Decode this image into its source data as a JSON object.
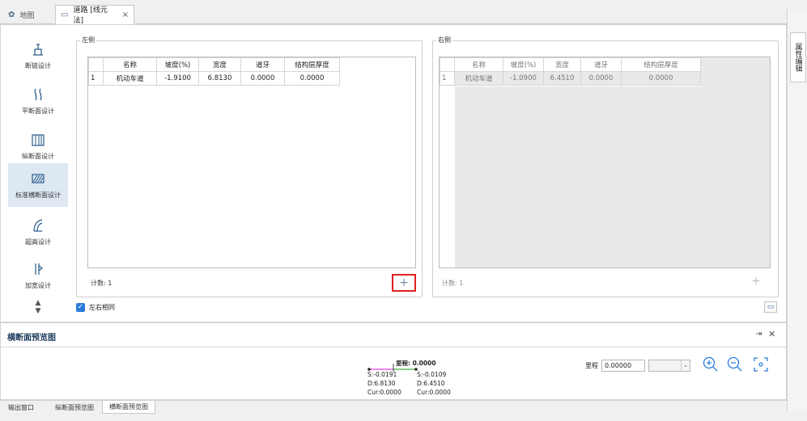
{
  "tabs": [
    {
      "label": "地图",
      "icon": "gear-icon"
    },
    {
      "label": "道路 [线元法]",
      "icon": "road-icon",
      "close": "×"
    }
  ],
  "right_panel_tab": "属性编辑",
  "sidebar": {
    "items": [
      {
        "label": "断链设计",
        "icon": "chain-break-icon"
      },
      {
        "label": "平断面设计",
        "icon": "plan-curve-icon"
      },
      {
        "label": "纵断面设计",
        "icon": "profile-icon"
      },
      {
        "label": "标准横断面设计",
        "icon": "cross-section-icon"
      },
      {
        "label": "超高设计",
        "icon": "superelevation-icon"
      },
      {
        "label": "加宽设计",
        "icon": "widening-icon"
      }
    ]
  },
  "left": {
    "title": "左侧",
    "columns": [
      "名称",
      "坡度(%)",
      "宽度",
      "道牙",
      "结构层厚度"
    ],
    "rows": [
      {
        "idx": "1",
        "cells": [
          "机动车道",
          "-1.9100",
          "6.8130",
          "0.0000",
          "0.0000"
        ]
      }
    ],
    "count_label": "计数: 1",
    "add_button": "+"
  },
  "right": {
    "title": "右侧",
    "columns": [
      "名称",
      "坡度(%)",
      "宽度",
      "道牙",
      "结构层厚度"
    ],
    "rows": [
      {
        "idx": "1",
        "cells": [
          "机动车道",
          "-1.0900",
          "6.4510",
          "0.0000",
          "0.0000"
        ]
      }
    ],
    "count_label": "计数: 1",
    "add_button": "+"
  },
  "same_both_sides": {
    "label": "左右相同",
    "checked": true
  },
  "preview": {
    "title": "横断面预览图",
    "mileage_header": "里程: 0.0000",
    "left_info": [
      "S:-0.0191",
      "D:6.8130",
      "Cur:0.0000"
    ],
    "right_info": [
      "S:-0.0109",
      "D:6.4510",
      "Cur:0.0000"
    ],
    "mileage_label": "里程",
    "mileage_value": "0.00000",
    "colors": {
      "left_line": "#e040e0",
      "right_line": "#40b040",
      "accent": "#2a7ad8"
    }
  },
  "bottom_tabs": [
    "输出窗口",
    "纵断面预览图",
    "横断面预览图"
  ]
}
